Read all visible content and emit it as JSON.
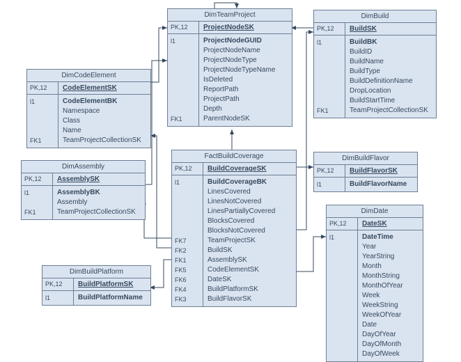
{
  "tables": {
    "dimTeamProject": {
      "title": "DimTeamProject",
      "pk_key": "PK,12",
      "pk": "ProjectNodeSK",
      "sections": [
        {
          "keys": [
            "l1",
            "",
            "",
            "",
            "",
            "",
            "",
            "",
            "FK1"
          ],
          "fields": [
            "ProjectNodeGUID",
            "ProjectNodeName",
            "ProjectNodeType",
            "ProjectNodeTypeName",
            "IsDeleted",
            "ReportPath",
            "ProjectPath",
            "Depth",
            "ParentNodeSK"
          ],
          "boldFirst": true
        }
      ]
    },
    "dimBuild": {
      "title": "DimBuild",
      "pk_key": "PK,12",
      "pk": "BuildSK",
      "sections": [
        {
          "keys": [
            "l1",
            "",
            "",
            "",
            "",
            "",
            "",
            "FK1"
          ],
          "fields": [
            "BuildBK",
            "BuildID",
            "BuildName",
            "BuildType",
            "BuildDefinitionName",
            "DropLocation",
            "BuildStartTime",
            "TeamProjectCollectionSK"
          ],
          "boldFirst": true
        }
      ]
    },
    "dimCodeElement": {
      "title": "DimCodeElement",
      "pk_key": "PK,12",
      "pk": "CodeElementSK",
      "sections": [
        {
          "keys": [
            "l1",
            "",
            "",
            "",
            "FK1"
          ],
          "fields": [
            "CodeElementBK",
            "Namespace",
            "Class",
            "Name",
            "TeamProjectCollectionSK"
          ],
          "boldFirst": true
        }
      ]
    },
    "dimAssembly": {
      "title": "DimAssembly",
      "pk_key": "PK,12",
      "pk": "AssemblySK",
      "sections": [
        {
          "keys": [
            "l1",
            "",
            "FK1"
          ],
          "fields": [
            "AssemblyBK",
            "Assembly",
            "TeamProjectCollectionSK"
          ],
          "boldFirst": true
        }
      ]
    },
    "factBuildCoverage": {
      "title": "FactBuildCoverage",
      "pk_key": "PK,12",
      "pk": "BuildCoverageSK",
      "sections": [
        {
          "keys": [
            "l1",
            "",
            "",
            "",
            "",
            "",
            "FK7",
            "FK2",
            "FK1",
            "FK5",
            "FK6",
            "FK4",
            "FK3"
          ],
          "fields": [
            "BuildCoverageBK",
            "LinesCovered",
            "LinesNotCovered",
            "LinesPartiallyCovered",
            "BlocksCovered",
            "BlocksNotCovered",
            "TeamProjectSK",
            "BuildSK",
            "AssemblySK",
            "CodeElementSK",
            "DateSK",
            "BuildPlatformSK",
            "BuildFlavorSK"
          ],
          "boldFirst": true
        }
      ]
    },
    "dimBuildFlavor": {
      "title": "DimBuildFlavor",
      "pk_key": "PK,12",
      "pk": "BuildFlavorSK",
      "sections": [
        {
          "keys": [
            "l1"
          ],
          "fields": [
            "BuildFlavorName"
          ],
          "boldFirst": true
        }
      ]
    },
    "dimDate": {
      "title": "DimDate",
      "pk_key": "PK,12",
      "pk": "DateSK",
      "sections": [
        {
          "keys": [
            "l1",
            "",
            "",
            "",
            "",
            "",
            "",
            "",
            "",
            "",
            "",
            "",
            ""
          ],
          "fields": [
            "DateTime",
            "Year",
            "YearString",
            "Month",
            "MonthString",
            "MonthOfYear",
            "Week",
            "WeekString",
            "WeekOfYear",
            "Date",
            "DayOfYear",
            "DayOfMonth",
            "DayOfWeek"
          ],
          "boldFirst": true
        }
      ]
    },
    "dimBuildPlatform": {
      "title": "DimBuildPlatform",
      "pk_key": "PK,12",
      "pk": "BuildPlatformSK",
      "sections": [
        {
          "keys": [
            "l1"
          ],
          "fields": [
            "BuildPlatformName"
          ],
          "boldFirst": true
        }
      ]
    }
  },
  "chart_data": {
    "type": "table",
    "title": "Build Coverage Star Schema (ER Diagram)",
    "entities": [
      {
        "name": "DimTeamProject",
        "pk": "ProjectNodeSK",
        "attributes": [
          "ProjectNodeGUID",
          "ProjectNodeName",
          "ProjectNodeType",
          "ProjectNodeTypeName",
          "IsDeleted",
          "ReportPath",
          "ProjectPath",
          "Depth",
          "ParentNodeSK"
        ]
      },
      {
        "name": "DimBuild",
        "pk": "BuildSK",
        "attributes": [
          "BuildBK",
          "BuildID",
          "BuildName",
          "BuildType",
          "BuildDefinitionName",
          "DropLocation",
          "BuildStartTime",
          "TeamProjectCollectionSK"
        ]
      },
      {
        "name": "DimCodeElement",
        "pk": "CodeElementSK",
        "attributes": [
          "CodeElementBK",
          "Namespace",
          "Class",
          "Name",
          "TeamProjectCollectionSK"
        ]
      },
      {
        "name": "DimAssembly",
        "pk": "AssemblySK",
        "attributes": [
          "AssemblyBK",
          "Assembly",
          "TeamProjectCollectionSK"
        ]
      },
      {
        "name": "FactBuildCoverage",
        "pk": "BuildCoverageSK",
        "attributes": [
          "BuildCoverageBK",
          "LinesCovered",
          "LinesNotCovered",
          "LinesPartiallyCovered",
          "BlocksCovered",
          "BlocksNotCovered",
          "TeamProjectSK",
          "BuildSK",
          "AssemblySK",
          "CodeElementSK",
          "DateSK",
          "BuildPlatformSK",
          "BuildFlavorSK"
        ]
      },
      {
        "name": "DimBuildFlavor",
        "pk": "BuildFlavorSK",
        "attributes": [
          "BuildFlavorName"
        ]
      },
      {
        "name": "DimDate",
        "pk": "DateSK",
        "attributes": [
          "DateTime",
          "Year",
          "YearString",
          "Month",
          "MonthString",
          "MonthOfYear",
          "Week",
          "WeekString",
          "WeekOfYear",
          "Date",
          "DayOfYear",
          "DayOfMonth",
          "DayOfWeek"
        ]
      },
      {
        "name": "DimBuildPlatform",
        "pk": "BuildPlatformSK",
        "attributes": [
          "BuildPlatformName"
        ]
      }
    ],
    "relationships": [
      {
        "from": "FactBuildCoverage",
        "to": "DimTeamProject",
        "fk": "TeamProjectSK"
      },
      {
        "from": "FactBuildCoverage",
        "to": "DimBuild",
        "fk": "BuildSK"
      },
      {
        "from": "FactBuildCoverage",
        "to": "DimAssembly",
        "fk": "AssemblySK"
      },
      {
        "from": "FactBuildCoverage",
        "to": "DimCodeElement",
        "fk": "CodeElementSK"
      },
      {
        "from": "FactBuildCoverage",
        "to": "DimDate",
        "fk": "DateSK"
      },
      {
        "from": "FactBuildCoverage",
        "to": "DimBuildPlatform",
        "fk": "BuildPlatformSK"
      },
      {
        "from": "FactBuildCoverage",
        "to": "DimBuildFlavor",
        "fk": "BuildFlavorSK"
      },
      {
        "from": "DimBuild",
        "to": "DimTeamProject",
        "fk": "TeamProjectCollectionSK"
      },
      {
        "from": "DimCodeElement",
        "to": "DimTeamProject",
        "fk": "TeamProjectCollectionSK"
      },
      {
        "from": "DimAssembly",
        "to": "DimTeamProject",
        "fk": "TeamProjectCollectionSK"
      },
      {
        "from": "DimTeamProject",
        "to": "DimTeamProject",
        "fk": "ParentNodeSK"
      }
    ]
  }
}
